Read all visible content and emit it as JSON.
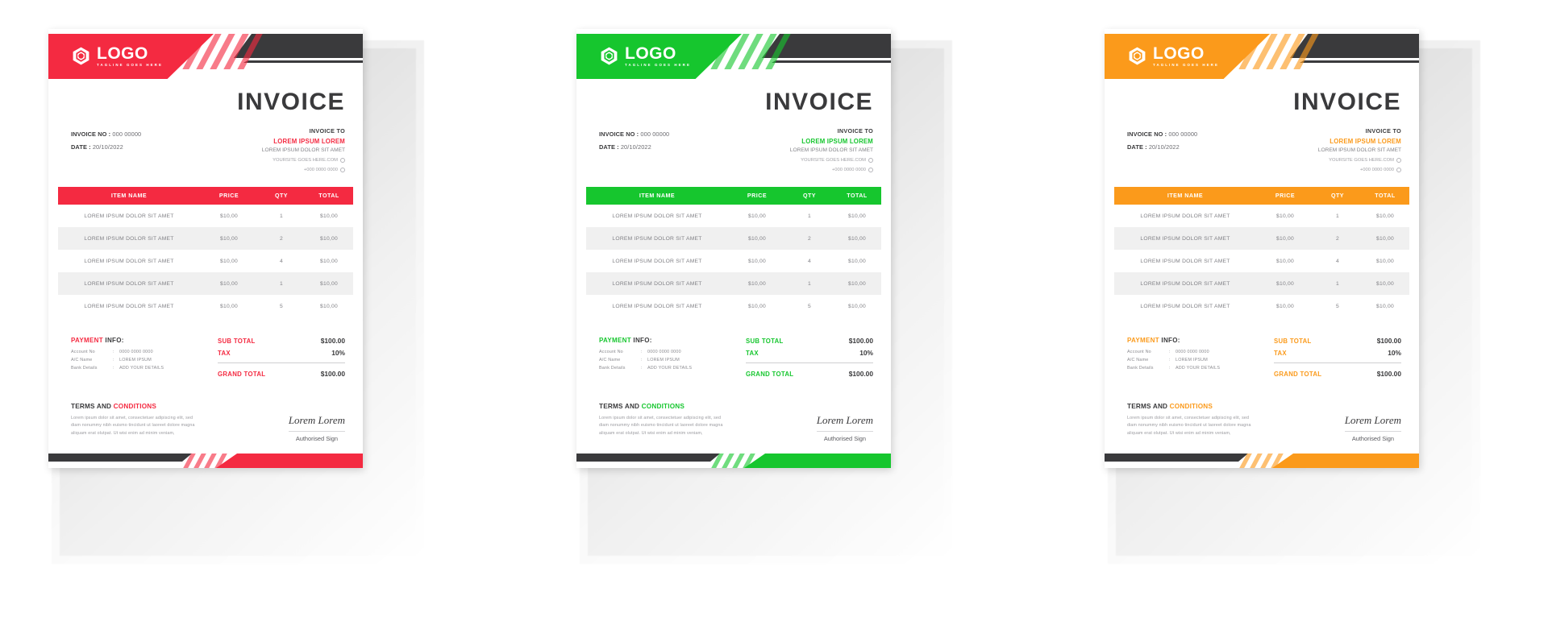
{
  "document": {
    "type": "invoice-template-set",
    "variant_count": 3
  },
  "brand": {
    "logo_title": "LOGO",
    "logo_tagline": "TAGLINE GOES HERE",
    "logo_icon": "hexagon-target-icon"
  },
  "header": {
    "title": "INVOICE"
  },
  "meta": {
    "invoice_no_label": "INVOICE NO :",
    "invoice_no_value": "000 00000",
    "date_label": "DATE :",
    "date_value": "20/10/2022"
  },
  "invoice_to": {
    "label": "INVOICE TO",
    "name": "LOREM IPSUM LOREM",
    "address": "LOREM IPSUM DOLOR SIT AMET",
    "website": "YOURSITE GOES HERE.COM",
    "phone": "+000 0000 0000"
  },
  "table": {
    "columns": [
      "ITEM NAME",
      "PRICE",
      "QTY",
      "TOTAL"
    ],
    "rows": [
      {
        "item": "LOREM IPSUM DOLOR SIT AMET",
        "price": "$10,00",
        "qty": "1",
        "total": "$10,00"
      },
      {
        "item": "LOREM IPSUM DOLOR SIT AMET",
        "price": "$10,00",
        "qty": "2",
        "total": "$10,00"
      },
      {
        "item": "LOREM IPSUM DOLOR SIT AMET",
        "price": "$10,00",
        "qty": "4",
        "total": "$10,00"
      },
      {
        "item": "LOREM IPSUM DOLOR SIT AMET",
        "price": "$10,00",
        "qty": "1",
        "total": "$10,00"
      },
      {
        "item": "LOREM IPSUM DOLOR SIT AMET",
        "price": "$10,00",
        "qty": "5",
        "total": "$10,00"
      }
    ]
  },
  "payment_info": {
    "title_colored": "PAYMENT",
    "title_dark": "INFO:",
    "lines": [
      {
        "key": "Account No",
        "colon": ":",
        "value": "0000 0000 0000"
      },
      {
        "key": "A/C Name",
        "colon": ":",
        "value": "LOREM IPSUM"
      },
      {
        "key": "Bank Details",
        "colon": ":",
        "value": "ADD YOUR DETAILS"
      }
    ]
  },
  "totals": {
    "sub_total_label": "SUB TOTAL",
    "sub_total_value": "$100.00",
    "tax_label": "TAX",
    "tax_value": "10%",
    "grand_total_label": "GRAND TOTAL",
    "grand_total_value": "$100.00"
  },
  "terms": {
    "title_dark": "TERMS AND",
    "title_colored": "CONDITIONS",
    "body": "Lorem ipsum dolor sit amet, consectetuer adipiscing elit, sed diam nonummy nibh euismo tincidunt ut laoreet dolore magna aliquam erat olutpat. Ut wisi enim ad minim veniam,"
  },
  "signature": {
    "name": "Lorem Lorem",
    "label": "Authorised Sign"
  },
  "variants": [
    {
      "id": "red",
      "accent": "#F42A41",
      "accent_dark": "#E51F36",
      "name": "red-invoice"
    },
    {
      "id": "green",
      "accent": "#16C62E",
      "accent_dark": "#0FB326",
      "name": "green-invoice"
    },
    {
      "id": "orange",
      "accent": "#FB9A1B",
      "accent_dark": "#F08E0F",
      "name": "orange-invoice"
    }
  ],
  "colors": {
    "dark": "#3a3a3c",
    "row_alt": "#f0f0f0",
    "text_muted": "#85858a",
    "page_bg": "#ffffff"
  }
}
